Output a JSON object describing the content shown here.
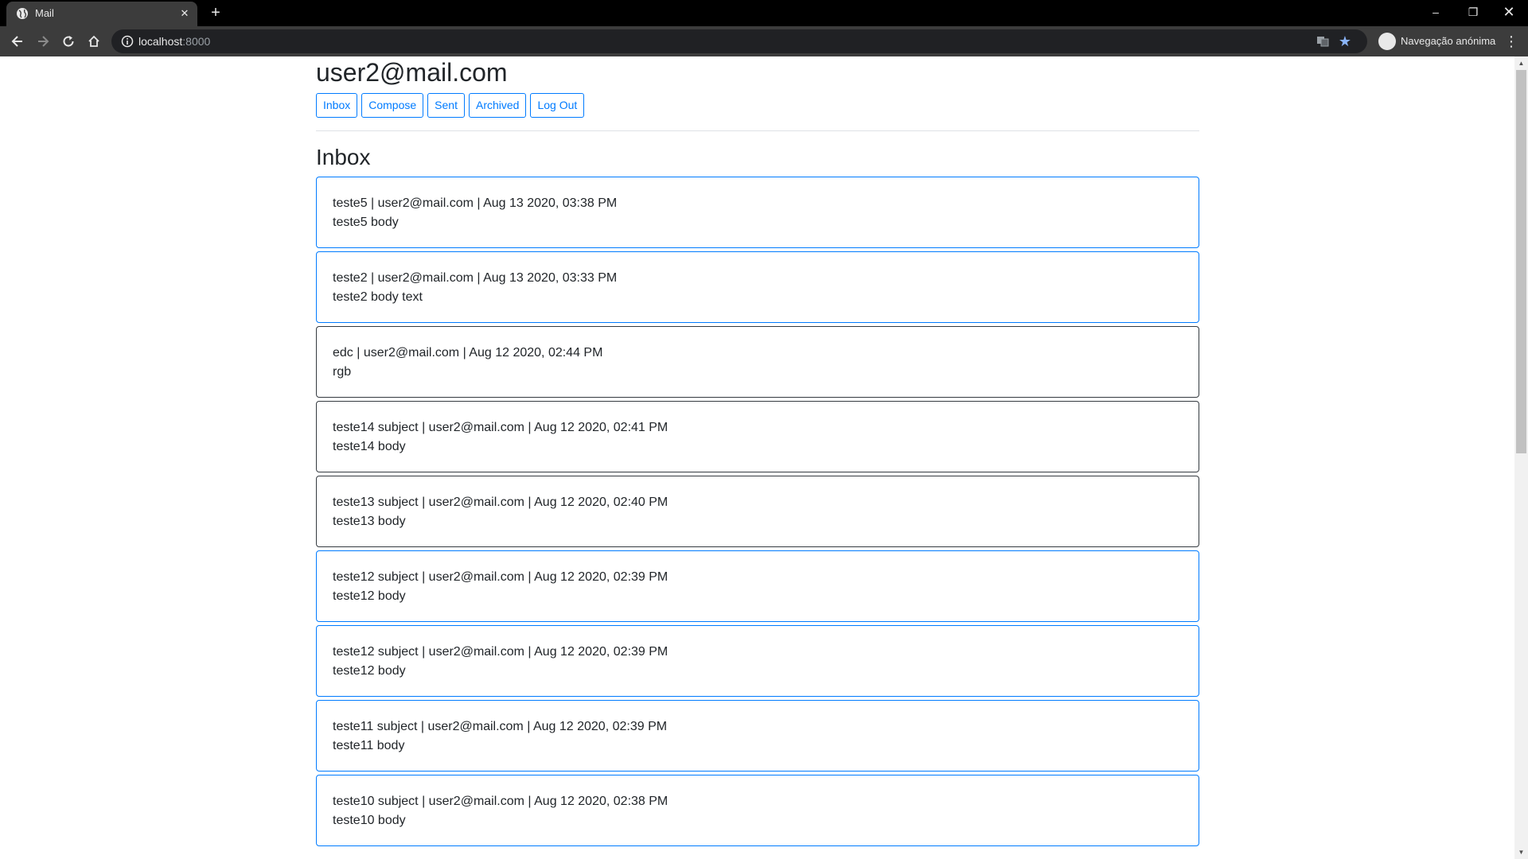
{
  "browser": {
    "tab_title": "Mail",
    "url_host": "localhost",
    "url_port": ":8000",
    "incognito_label": "Navegação anónima"
  },
  "page": {
    "user_email": "user2@mail.com",
    "nav": {
      "inbox": "Inbox",
      "compose": "Compose",
      "sent": "Sent",
      "archived": "Archived",
      "logout": "Log Out"
    },
    "view_title": "Inbox"
  },
  "emails": [
    {
      "subject": "teste5",
      "sender": "user2@mail.com",
      "timestamp": "Aug 13 2020, 03:38 PM",
      "body": "teste5 body",
      "read": false
    },
    {
      "subject": "teste2",
      "sender": "user2@mail.com",
      "timestamp": "Aug 13 2020, 03:33 PM",
      "body": "teste2 body text",
      "read": false
    },
    {
      "subject": "edc",
      "sender": "user2@mail.com",
      "timestamp": "Aug 12 2020, 02:44 PM",
      "body": "rgb",
      "read": true
    },
    {
      "subject": "teste14 subject",
      "sender": "user2@mail.com",
      "timestamp": "Aug 12 2020, 02:41 PM",
      "body": "teste14 body",
      "read": true
    },
    {
      "subject": "teste13 subject",
      "sender": "user2@mail.com",
      "timestamp": "Aug 12 2020, 02:40 PM",
      "body": "teste13 body",
      "read": true
    },
    {
      "subject": "teste12 subject",
      "sender": "user2@mail.com",
      "timestamp": "Aug 12 2020, 02:39 PM",
      "body": "teste12 body",
      "read": false
    },
    {
      "subject": "teste12 subject",
      "sender": "user2@mail.com",
      "timestamp": "Aug 12 2020, 02:39 PM",
      "body": "teste12 body",
      "read": false
    },
    {
      "subject": "teste11 subject",
      "sender": "user2@mail.com",
      "timestamp": "Aug 12 2020, 02:39 PM",
      "body": "teste11 body",
      "read": false
    },
    {
      "subject": "teste10 subject",
      "sender": "user2@mail.com",
      "timestamp": "Aug 12 2020, 02:38 PM",
      "body": "teste10 body",
      "read": false
    }
  ],
  "colors": {
    "accent": "#007bff",
    "read_border": "#343a40",
    "chrome_dark": "#3c3c3c"
  }
}
